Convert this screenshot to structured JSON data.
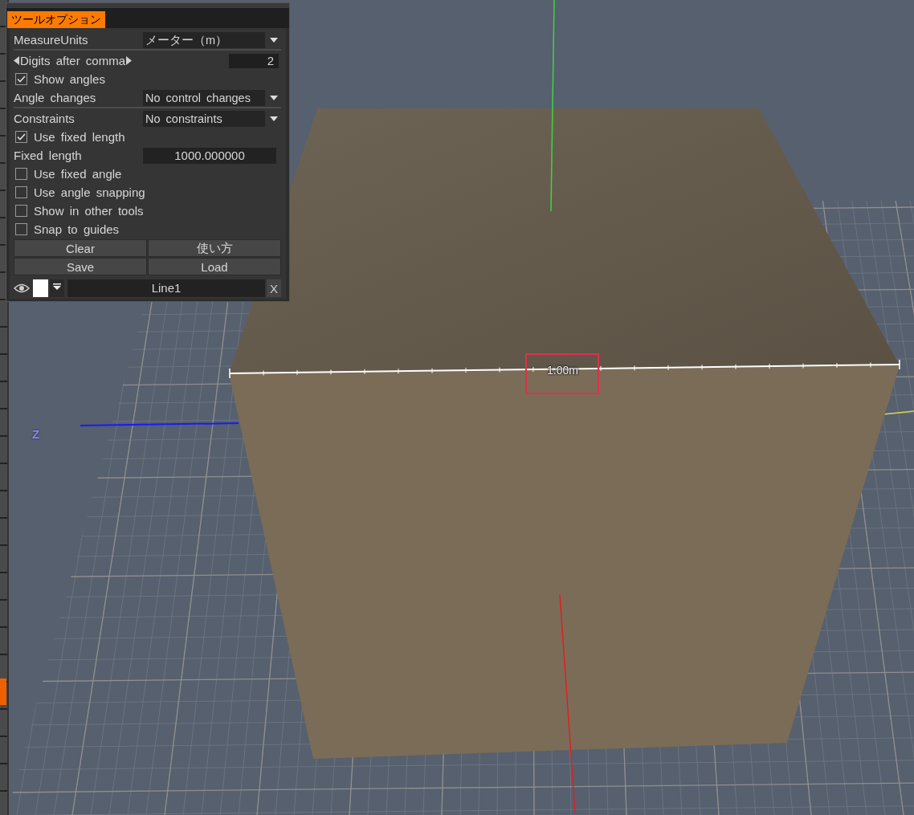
{
  "panel": {
    "title": "ツールオプション",
    "rows": [
      {
        "kind": "select",
        "label": "MeasureUnits",
        "value": "メーター（m）"
      },
      {
        "kind": "separator"
      },
      {
        "kind": "spinner",
        "label": "Digits after comma",
        "value": "2"
      },
      {
        "kind": "checkbox",
        "label": "Show angles",
        "checked": true
      },
      {
        "kind": "select",
        "label": "Angle changes",
        "value": "No control changes"
      },
      {
        "kind": "separator"
      },
      {
        "kind": "select",
        "label": "Constraints",
        "value": "No constraints"
      },
      {
        "kind": "checkbox",
        "label": "Use fixed length",
        "checked": true
      },
      {
        "kind": "input",
        "label": "Fixed length",
        "value": "1000.000000"
      },
      {
        "kind": "checkbox",
        "label": "Use fixed angle",
        "checked": false
      },
      {
        "kind": "checkbox",
        "label": "Use angle snapping",
        "checked": false
      },
      {
        "kind": "checkbox",
        "label": "Show in other tools",
        "checked": false
      },
      {
        "kind": "checkbox",
        "label": "Snap to guides",
        "checked": false
      }
    ],
    "buttons": [
      "Clear",
      "使い方",
      "Save",
      "Load"
    ],
    "line": {
      "name": "Line1",
      "close": "X"
    }
  },
  "viewport": {
    "axis_label": "Z",
    "measurement": "1.00m"
  }
}
